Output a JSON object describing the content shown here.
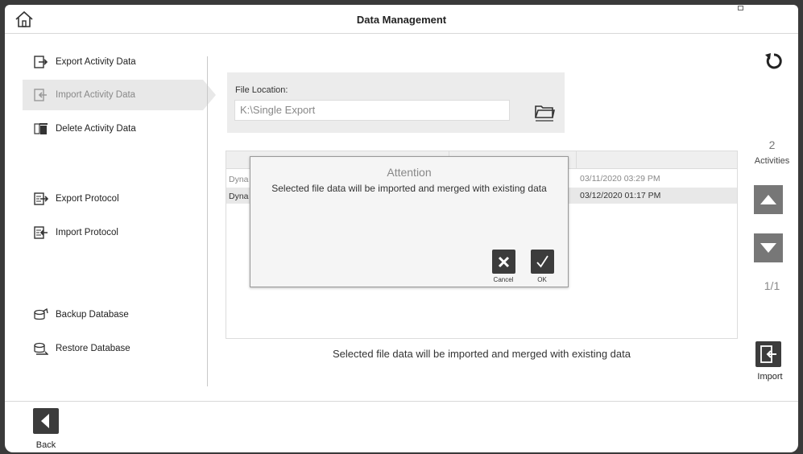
{
  "header": {
    "title": "Data Management"
  },
  "sidebar": {
    "items": [
      {
        "label": "Export Activity Data",
        "icon": "export-icon"
      },
      {
        "label": "Import Activity Data",
        "icon": "import-icon",
        "active": true
      },
      {
        "label": "Delete Activity Data",
        "icon": "trash-icon"
      },
      {
        "label": "Export Protocol",
        "icon": "export-protocol-icon"
      },
      {
        "label": "Import Protocol",
        "icon": "import-protocol-icon"
      },
      {
        "label": "Backup Database",
        "icon": "backup-icon"
      },
      {
        "label": "Restore Database",
        "icon": "restore-icon"
      }
    ]
  },
  "file": {
    "label": "File Location:",
    "value": "K:\\Single Export"
  },
  "table": {
    "rows": [
      {
        "name": "Dyna",
        "date": "03/11/2020 03:29 PM"
      },
      {
        "name": "Dyna",
        "date": "03/12/2020 01:17 PM"
      }
    ]
  },
  "dialog": {
    "title": "Attention",
    "message": "Selected file data will be imported and merged with existing data",
    "cancel_label": "Cancel",
    "ok_label": "OK"
  },
  "status_message": "Selected file data will be imported and merged with existing data",
  "right_panel": {
    "count": "2",
    "count_label": "Activities",
    "page": "1/1",
    "import_label": "Import"
  },
  "footer": {
    "back_label": "Back"
  },
  "colors": {
    "button_dark": "#3c3c3c",
    "nav_gray": "#777777",
    "active_bg": "#e8e8e8"
  }
}
